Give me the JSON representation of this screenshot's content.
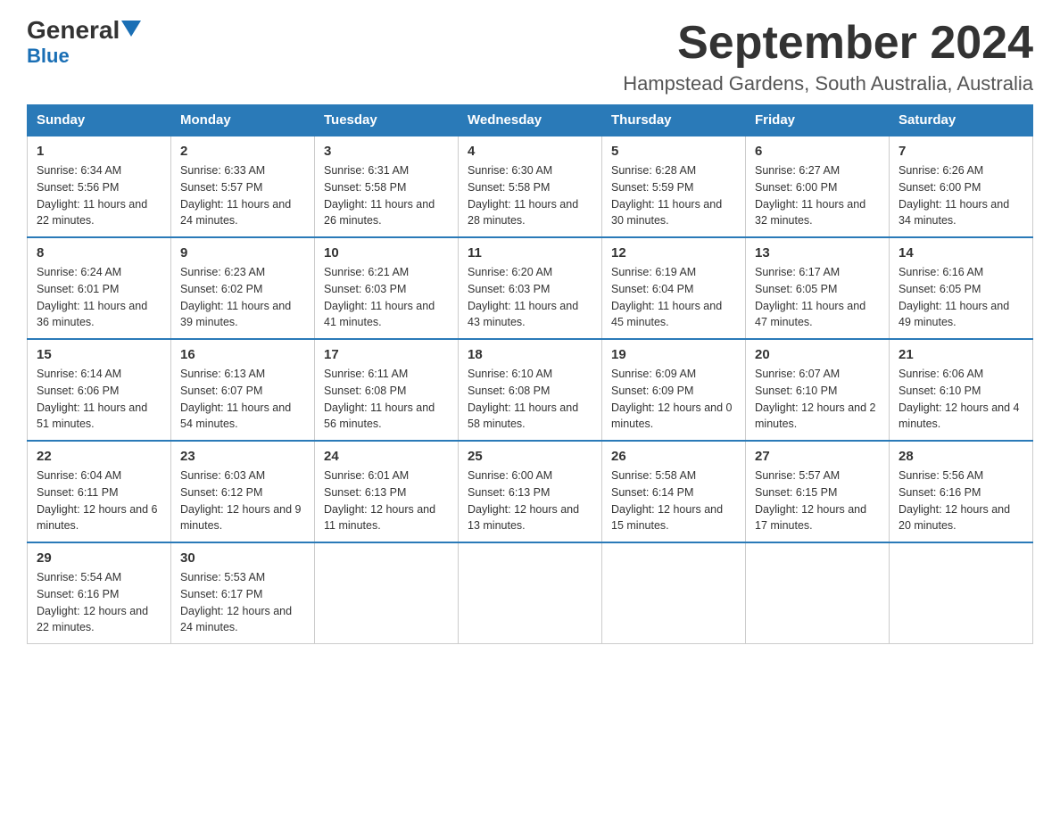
{
  "header": {
    "logo_line1": "General",
    "logo_line2": "Blue",
    "month_title": "September 2024",
    "location": "Hampstead Gardens, South Australia, Australia"
  },
  "calendar": {
    "days_of_week": [
      "Sunday",
      "Monday",
      "Tuesday",
      "Wednesday",
      "Thursday",
      "Friday",
      "Saturday"
    ],
    "weeks": [
      [
        {
          "day": "1",
          "sunrise": "6:34 AM",
          "sunset": "5:56 PM",
          "daylight": "11 hours and 22 minutes."
        },
        {
          "day": "2",
          "sunrise": "6:33 AM",
          "sunset": "5:57 PM",
          "daylight": "11 hours and 24 minutes."
        },
        {
          "day": "3",
          "sunrise": "6:31 AM",
          "sunset": "5:58 PM",
          "daylight": "11 hours and 26 minutes."
        },
        {
          "day": "4",
          "sunrise": "6:30 AM",
          "sunset": "5:58 PM",
          "daylight": "11 hours and 28 minutes."
        },
        {
          "day": "5",
          "sunrise": "6:28 AM",
          "sunset": "5:59 PM",
          "daylight": "11 hours and 30 minutes."
        },
        {
          "day": "6",
          "sunrise": "6:27 AM",
          "sunset": "6:00 PM",
          "daylight": "11 hours and 32 minutes."
        },
        {
          "day": "7",
          "sunrise": "6:26 AM",
          "sunset": "6:00 PM",
          "daylight": "11 hours and 34 minutes."
        }
      ],
      [
        {
          "day": "8",
          "sunrise": "6:24 AM",
          "sunset": "6:01 PM",
          "daylight": "11 hours and 36 minutes."
        },
        {
          "day": "9",
          "sunrise": "6:23 AM",
          "sunset": "6:02 PM",
          "daylight": "11 hours and 39 minutes."
        },
        {
          "day": "10",
          "sunrise": "6:21 AM",
          "sunset": "6:03 PM",
          "daylight": "11 hours and 41 minutes."
        },
        {
          "day": "11",
          "sunrise": "6:20 AM",
          "sunset": "6:03 PM",
          "daylight": "11 hours and 43 minutes."
        },
        {
          "day": "12",
          "sunrise": "6:19 AM",
          "sunset": "6:04 PM",
          "daylight": "11 hours and 45 minutes."
        },
        {
          "day": "13",
          "sunrise": "6:17 AM",
          "sunset": "6:05 PM",
          "daylight": "11 hours and 47 minutes."
        },
        {
          "day": "14",
          "sunrise": "6:16 AM",
          "sunset": "6:05 PM",
          "daylight": "11 hours and 49 minutes."
        }
      ],
      [
        {
          "day": "15",
          "sunrise": "6:14 AM",
          "sunset": "6:06 PM",
          "daylight": "11 hours and 51 minutes."
        },
        {
          "day": "16",
          "sunrise": "6:13 AM",
          "sunset": "6:07 PM",
          "daylight": "11 hours and 54 minutes."
        },
        {
          "day": "17",
          "sunrise": "6:11 AM",
          "sunset": "6:08 PM",
          "daylight": "11 hours and 56 minutes."
        },
        {
          "day": "18",
          "sunrise": "6:10 AM",
          "sunset": "6:08 PM",
          "daylight": "11 hours and 58 minutes."
        },
        {
          "day": "19",
          "sunrise": "6:09 AM",
          "sunset": "6:09 PM",
          "daylight": "12 hours and 0 minutes."
        },
        {
          "day": "20",
          "sunrise": "6:07 AM",
          "sunset": "6:10 PM",
          "daylight": "12 hours and 2 minutes."
        },
        {
          "day": "21",
          "sunrise": "6:06 AM",
          "sunset": "6:10 PM",
          "daylight": "12 hours and 4 minutes."
        }
      ],
      [
        {
          "day": "22",
          "sunrise": "6:04 AM",
          "sunset": "6:11 PM",
          "daylight": "12 hours and 6 minutes."
        },
        {
          "day": "23",
          "sunrise": "6:03 AM",
          "sunset": "6:12 PM",
          "daylight": "12 hours and 9 minutes."
        },
        {
          "day": "24",
          "sunrise": "6:01 AM",
          "sunset": "6:13 PM",
          "daylight": "12 hours and 11 minutes."
        },
        {
          "day": "25",
          "sunrise": "6:00 AM",
          "sunset": "6:13 PM",
          "daylight": "12 hours and 13 minutes."
        },
        {
          "day": "26",
          "sunrise": "5:58 AM",
          "sunset": "6:14 PM",
          "daylight": "12 hours and 15 minutes."
        },
        {
          "day": "27",
          "sunrise": "5:57 AM",
          "sunset": "6:15 PM",
          "daylight": "12 hours and 17 minutes."
        },
        {
          "day": "28",
          "sunrise": "5:56 AM",
          "sunset": "6:16 PM",
          "daylight": "12 hours and 20 minutes."
        }
      ],
      [
        {
          "day": "29",
          "sunrise": "5:54 AM",
          "sunset": "6:16 PM",
          "daylight": "12 hours and 22 minutes."
        },
        {
          "day": "30",
          "sunrise": "5:53 AM",
          "sunset": "6:17 PM",
          "daylight": "12 hours and 24 minutes."
        },
        null,
        null,
        null,
        null,
        null
      ]
    ],
    "labels": {
      "sunrise": "Sunrise:",
      "sunset": "Sunset:",
      "daylight": "Daylight:"
    }
  }
}
